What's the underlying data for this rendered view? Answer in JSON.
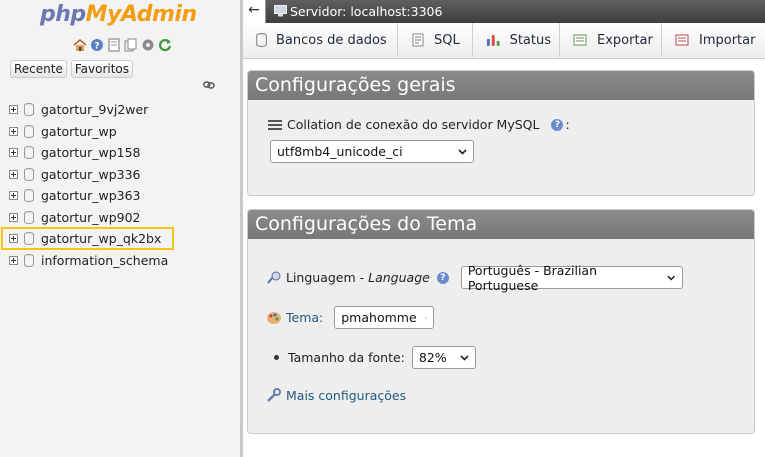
{
  "logo": {
    "part1": "php",
    "part2": "MyAdmin"
  },
  "nav": {
    "icons": [
      "home-icon",
      "info-icon",
      "docs-icon",
      "copy-icon",
      "settings-icon",
      "reload-icon"
    ],
    "tabs": [
      "Recente",
      "Favoritos"
    ],
    "databases": [
      "gatortur_9vj2wer",
      "gatortur_wp",
      "gatortur_wp158",
      "gatortur_wp336",
      "gatortur_wp363",
      "gatortur_wp902",
      "gatortur_wp_qk2bx",
      "information_schema"
    ],
    "highlighted_database": "gatortur_wp_qk2bx"
  },
  "topbar": {
    "back_glyph": "←",
    "server_label": "Servidor: localhost:3306"
  },
  "tabs": [
    "Bancos de dados",
    "SQL",
    "Status",
    "Exportar",
    "Importar"
  ],
  "general": {
    "title": "Configurações gerais",
    "collation_label": "Collation de conexão do servidor MySQL",
    "collation_suffix": ":",
    "collation_value": "utf8mb4_unicode_ci"
  },
  "theme": {
    "title": "Configurações do Tema",
    "language_label": "Linguagem - ",
    "language_label_italic": "Language",
    "language_value": "Português - Brazilian Portuguese",
    "theme_label": "Tema:",
    "theme_value": "pmahomme",
    "fontsize_label": "Tamanho da fonte:",
    "fontsize_value": "82%",
    "more_settings": "Mais configurações"
  },
  "colors": {
    "accent_highlight": "#f5c518",
    "panel_header": "#808080",
    "link": "#235a81"
  }
}
